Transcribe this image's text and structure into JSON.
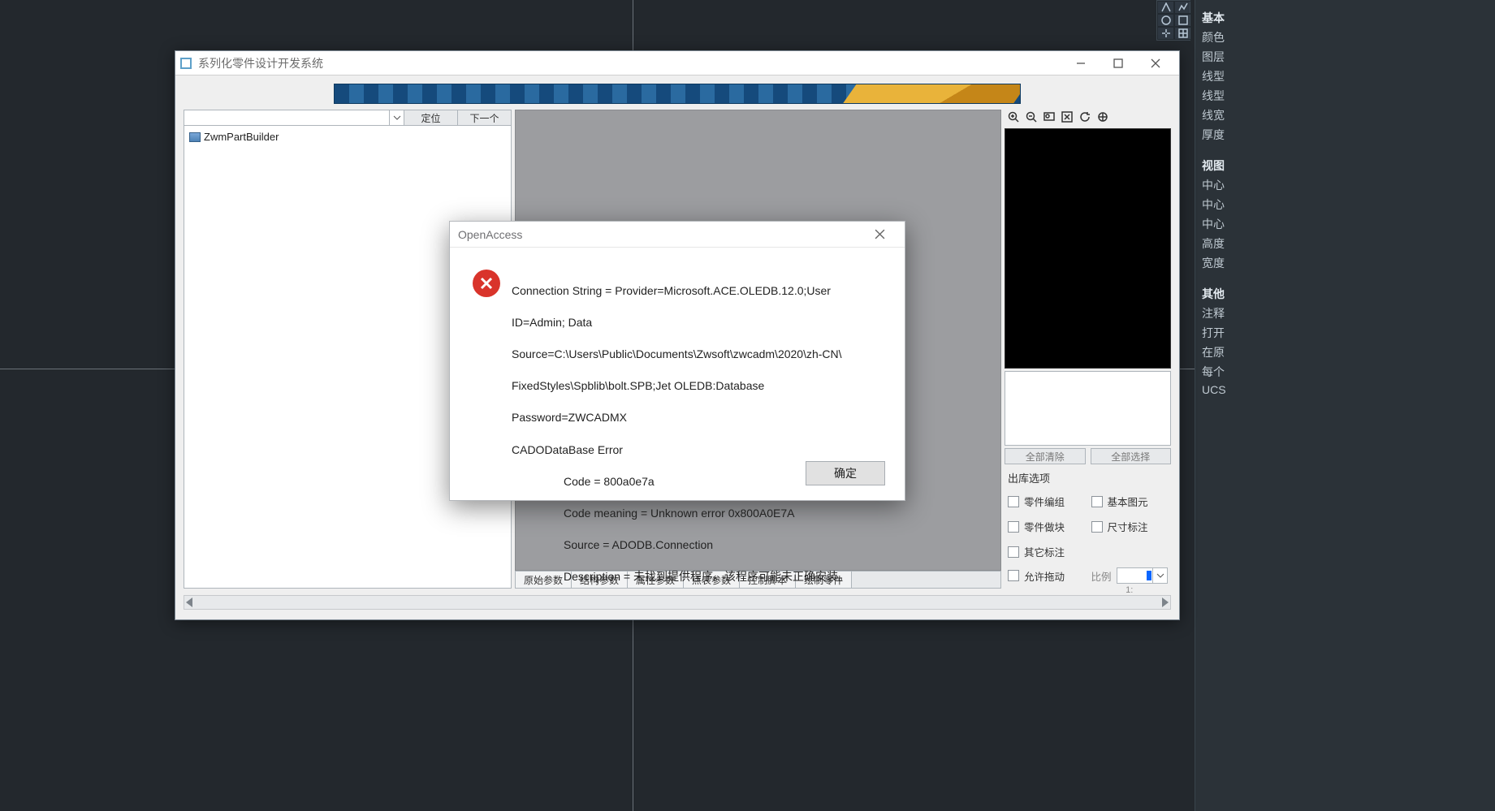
{
  "cad_palette": {
    "groups": [
      {
        "title": "基本",
        "items": [
          "颜色",
          "图层",
          "线型",
          "线型",
          "线宽",
          "厚度"
        ]
      },
      {
        "title": "视图",
        "items": [
          "中心",
          "中心",
          "中心",
          "高度",
          "宽度"
        ]
      },
      {
        "title": "其他",
        "items": [
          "注释",
          "打开",
          "在原",
          "每个",
          "UCS"
        ]
      }
    ]
  },
  "app": {
    "title": "系列化零件设计开发系统",
    "toolbar": {
      "locate": "定位",
      "next": "下一个"
    },
    "tree": {
      "root": "ZwmPartBuilder"
    },
    "tabs": [
      "原始参数",
      "结构参数",
      "属性参数",
      "点表参数",
      "控制脚本",
      "绘制零件"
    ],
    "selection": {
      "clear_all": "全部清除",
      "select_all": "全部选择"
    },
    "options": {
      "heading": "出库选项",
      "group_parts": "零件编组",
      "base_prim": "基本图元",
      "block_parts": "零件做块",
      "dim_anno": "尺寸标注",
      "other_anno": "其它标注",
      "allow_drag": "允许拖动",
      "ratio_label": "比例",
      "ratio_under": "1:"
    }
  },
  "dialog": {
    "title": "OpenAccess",
    "lines": {
      "l1": "Connection String = Provider=Microsoft.ACE.OLEDB.12.0;User",
      "l2": "ID=Admin; Data",
      "l3": "Source=C:\\Users\\Public\\Documents\\Zwsoft\\zwcadm\\2020\\zh-CN\\",
      "l4": "FixedStyles\\Spblib\\bolt.SPB;Jet OLEDB:Database",
      "l5": "Password=ZWCADMX",
      "l6": "CADODataBase Error",
      "c1": "Code = 800a0e7a",
      "c2": "Code meaning = Unknown error 0x800A0E7A",
      "c3": "Source = ADODB.Connection",
      "c4": "Description = 未找到提供程序。该程序可能未正确安装。"
    },
    "ok": "确定"
  }
}
